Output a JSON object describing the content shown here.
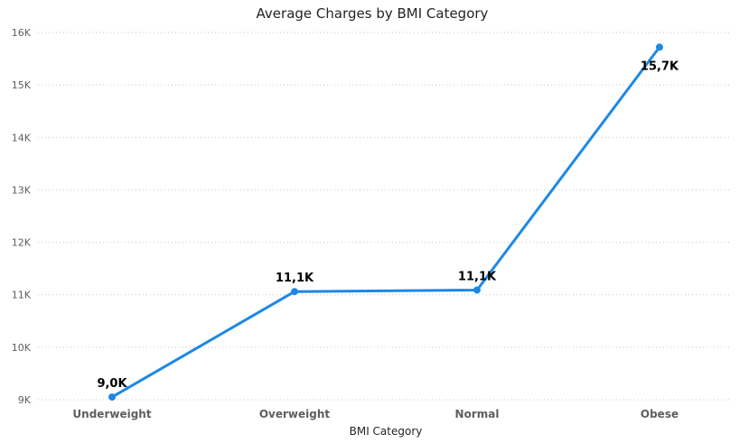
{
  "colors": {
    "line": "#1e88e5",
    "grid": "#c8c6c4",
    "tick_text": "#605e5c",
    "title_text": "#252423",
    "data_label": "#000000"
  },
  "chart_data": {
    "type": "line",
    "title": "Average Charges by BMI Category",
    "xlabel": "BMI Category",
    "ylabel": "",
    "categories": [
      "Underweight",
      "Overweight",
      "Normal",
      "Obese"
    ],
    "series": [
      {
        "values": [
          9050,
          11060,
          11090,
          15720
        ],
        "labels": [
          "9,0K",
          "11,1K",
          "11,1K",
          "15,7K"
        ]
      }
    ],
    "ylim": [
      9000,
      16000
    ],
    "yticks": [
      {
        "value": 9000,
        "label": "9K"
      },
      {
        "value": 10000,
        "label": "10K"
      },
      {
        "value": 11000,
        "label": "11K"
      },
      {
        "value": 12000,
        "label": "12K"
      },
      {
        "value": 13000,
        "label": "13K"
      },
      {
        "value": 14000,
        "label": "14K"
      },
      {
        "value": 15000,
        "label": "15K"
      },
      {
        "value": 16000,
        "label": "16K"
      }
    ],
    "grid": true,
    "legend": "none"
  }
}
